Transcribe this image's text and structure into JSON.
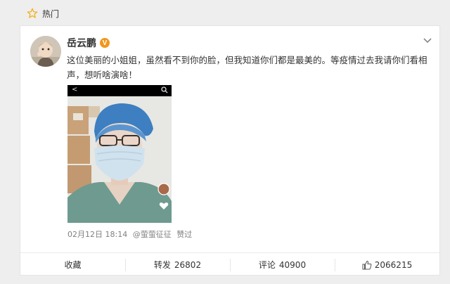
{
  "hot": {
    "label": "热门"
  },
  "post": {
    "username": "岳云鹏",
    "verified_badge": "V",
    "text": "这位美丽的小姐姐，虽然看不到你的脸，但我知道你们都是最美的。等疫情过去我请你们看相声，想听啥演啥！",
    "timestamp": "02月12日 18:14",
    "via": "@萤萤征征",
    "liked_label": "赞过"
  },
  "actions": {
    "favorite_label": "收藏",
    "repost_label": "转发",
    "repost_count": "26802",
    "comment_label": "评论",
    "comment_count": "40900",
    "like_count": "2066215"
  },
  "colors": {
    "hot_star": "#f2b21c",
    "verified": "#f2961c",
    "scrub_blue": "#3d7fc1",
    "mask_blue": "#cfe2ee"
  },
  "icons": [
    "star-icon",
    "chevron-down-icon",
    "back-arrow-icon",
    "search-icon",
    "heart-icon",
    "thumbs-up-icon"
  ]
}
